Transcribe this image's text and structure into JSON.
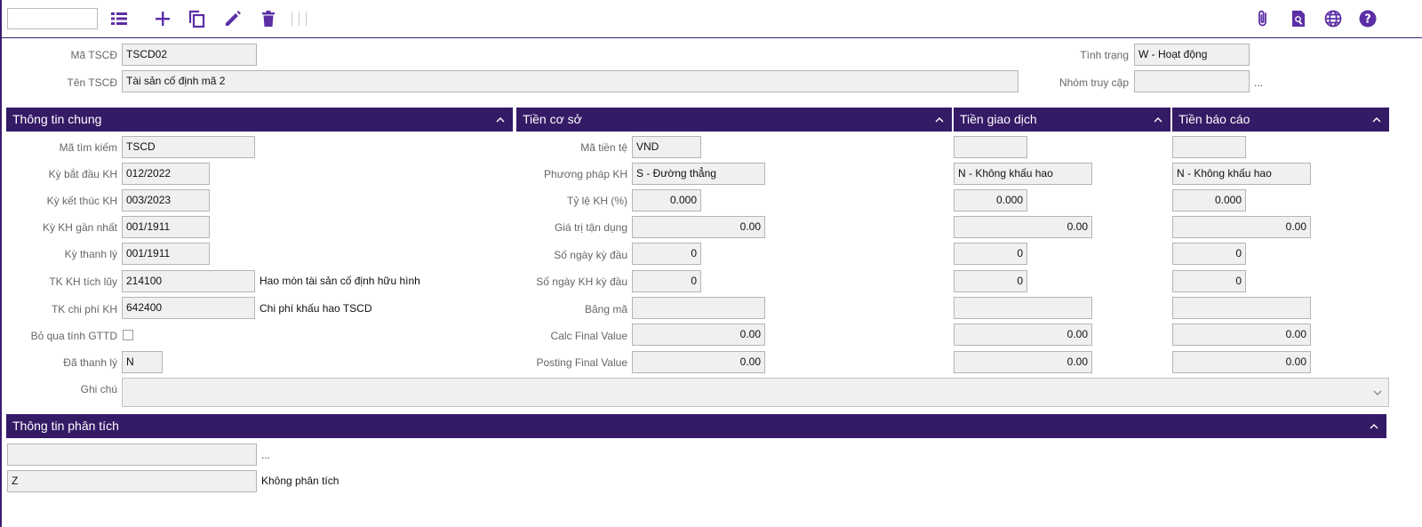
{
  "icons": {
    "list": "list-icon",
    "add": "plus-icon",
    "copy": "copy-icon",
    "edit": "pencil-icon",
    "delete": "trash-icon",
    "attach": "paperclip-icon",
    "preview": "search-document-icon",
    "language": "globe-icon",
    "help": "help-icon"
  },
  "colors": {
    "accent": "#5b2ea6",
    "header": "#351a66"
  },
  "header": {
    "asset_code_label": "Mã TSCĐ",
    "asset_code": "TSCD02",
    "asset_name_label": "Tên TSCĐ",
    "asset_name": "Tài sản cố định mã 2",
    "status_label": "Tình trạng",
    "status": "W - Hoạt động",
    "access_group_label": "Nhóm truy cập",
    "access_group": "",
    "access_dots": "..."
  },
  "sections": {
    "general": "Thông tin chung",
    "base_currency": "Tiền cơ sở",
    "transaction_currency": "Tiền giao dịch",
    "report_currency": "Tiền báo cáo",
    "analysis": "Thông tin phân tích"
  },
  "general": {
    "search_code_label": "Mã tìm kiếm",
    "search_code": "TSCD",
    "start_period_label": "Kỳ bắt đầu KH",
    "start_period": "012/2022",
    "end_period_label": "Kỳ kết thúc KH",
    "end_period": "003/2023",
    "last_period_label": "Kỳ KH gần nhất",
    "last_period": "001/1911",
    "liquidation_period_label": "Kỳ thanh lý",
    "liquidation_period": "001/1911",
    "accum_account_label": "TK KH tích lũy",
    "accum_account": "214100",
    "accum_account_desc": "Hao mòn tài sản cố định hữu hình",
    "expense_account_label": "TK chi phí KH",
    "expense_account": "642400",
    "expense_account_desc": "Chi phí khấu hao TSCD",
    "skip_residual_label": "Bỏ qua tính GTTD",
    "liquidated_label": "Đã thanh lý",
    "liquidated": "N",
    "notes_label": "Ghi chú",
    "notes": ""
  },
  "base": {
    "currency_label": "Mã tiền tệ",
    "currency": "VND",
    "method_label": "Phương pháp KH",
    "method": "S - Đường thẳng",
    "rate_label": "Tỷ lệ KH (%)",
    "rate": "0.000",
    "salvage_label": "Giá trị tận dụng",
    "salvage": "0.00",
    "first_days_label": "Số ngày kỳ đầu",
    "first_days": "0",
    "first_dep_days_label": "Số ngày KH kỳ đầu",
    "first_dep_days": "0",
    "table_code_label": "Bảng mã",
    "table_code": "",
    "calc_final_label": "Calc Final Value",
    "calc_final": "0.00",
    "posting_final_label": "Posting Final Value",
    "posting_final": "0.00"
  },
  "transaction": {
    "currency": "",
    "method": "N - Không khấu hao",
    "rate": "0.000",
    "salvage": "0.00",
    "first_days": "0",
    "first_dep_days": "0",
    "table_code": "",
    "calc_final": "0.00",
    "posting_final": "0.00"
  },
  "report": {
    "currency": "",
    "method": "N - Không khấu hao",
    "rate": "0.000",
    "salvage": "0.00",
    "first_days": "0",
    "first_dep_days": "0",
    "table_code": "",
    "calc_final": "0.00",
    "posting_final": "0.00"
  },
  "analysis": {
    "field1": "",
    "field1_dots": "...",
    "field2": "Z",
    "field2_desc": "Không phân tích"
  }
}
